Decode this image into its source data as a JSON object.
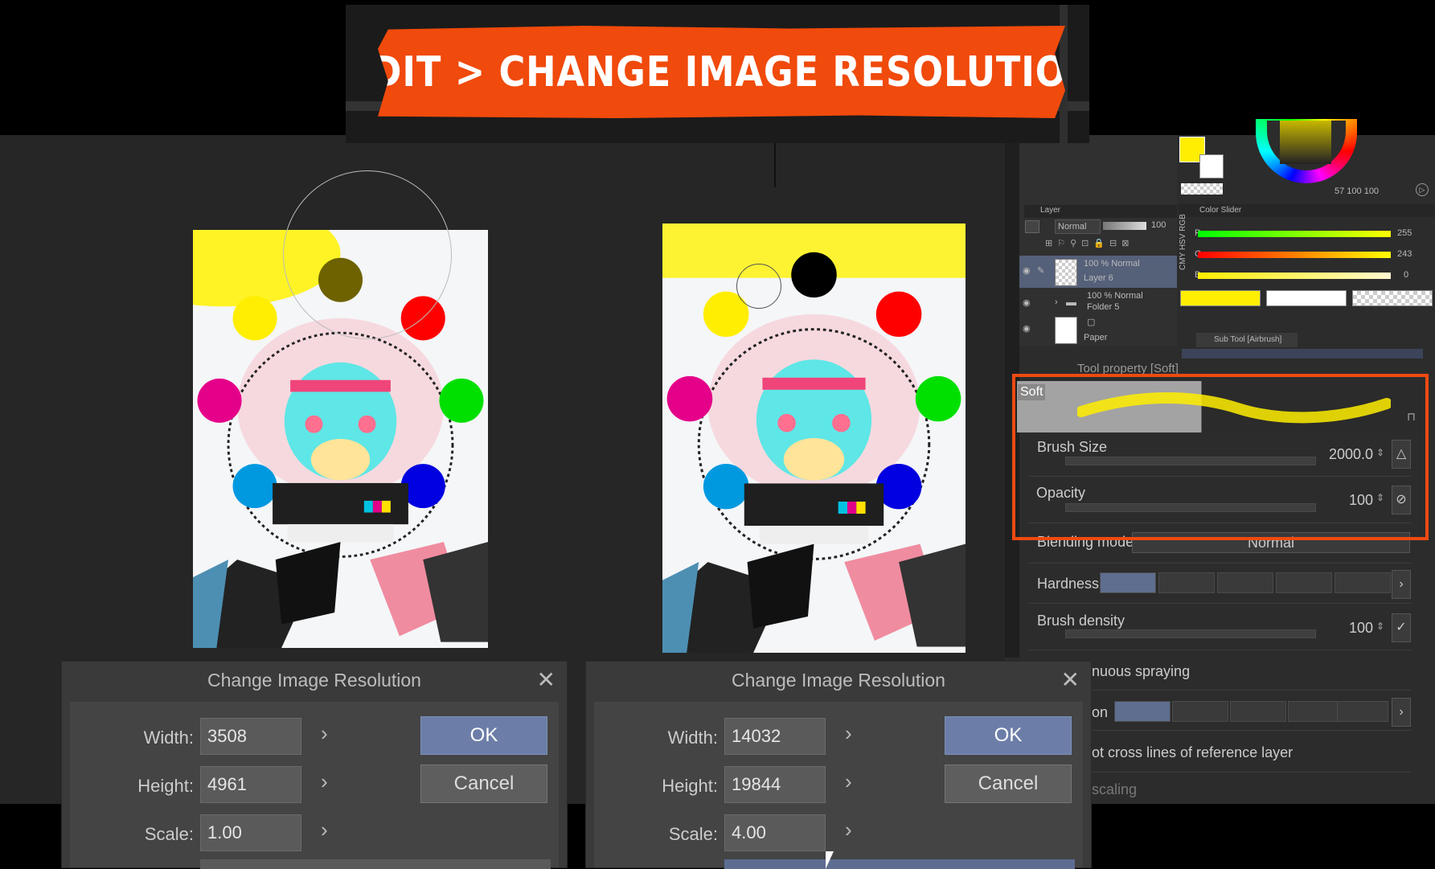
{
  "banner": {
    "text": "EDIT > CHANGE IMAGE RESOLUTION"
  },
  "dialogs": {
    "title": "Change Image Resolution",
    "width_label": "Width:",
    "height_label": "Height:",
    "scale_label": "Scale:",
    "ok_label": "OK",
    "cancel_label": "Cancel",
    "left": {
      "width": "3508",
      "height": "4961",
      "scale": "1.00"
    },
    "right": {
      "width": "14032",
      "height": "19844",
      "scale": "4.00"
    }
  },
  "layer_panel": {
    "title": "Layer",
    "blend_mode": "Normal",
    "opacity": "100",
    "layers": [
      {
        "line1": "100 % Normal",
        "line2": "Layer 6"
      },
      {
        "line1": "100 % Normal",
        "line2": "Folder 5"
      },
      {
        "line1": "",
        "line2": "Paper"
      }
    ]
  },
  "color_panel": {
    "title": "Color Slider",
    "hsv_readout": "57 100 100",
    "mode_tabs": "CMY HSV RGB",
    "channels": [
      {
        "label": "R",
        "value": "255"
      },
      {
        "label": "G",
        "value": "243"
      },
      {
        "label": "B",
        "value": "0"
      }
    ],
    "fg_color": "#ffee00"
  },
  "sub_tool": {
    "title": "Sub Tool [Airbrush]"
  },
  "tool_property": {
    "title": "Tool property [Soft]",
    "preview_label": "Soft",
    "brush_size_label": "Brush Size",
    "brush_size_value": "2000.0",
    "opacity_label": "Opacity",
    "opacity_value": "100",
    "blending_label": "Blending mode",
    "blending_value": "Normal",
    "hardness_label": "Hardness",
    "density_label": "Brush density",
    "density_value": "100",
    "spraying_label": "nuous spraying",
    "direction_label": "on",
    "ref_layer_label": "ot cross lines of reference layer",
    "scaling_label": "scaling"
  },
  "highlight_color": "#ee4a12"
}
